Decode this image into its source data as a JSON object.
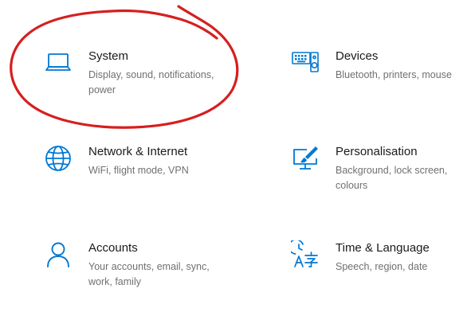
{
  "colors": {
    "accent": "#0078d4",
    "title": "#1a1a1a",
    "description": "#707070",
    "annotation": "#d61f1f"
  },
  "tiles": [
    {
      "icon": "laptop-icon",
      "title": "System",
      "description": "Display, sound, notifications, power"
    },
    {
      "icon": "keyboard-speaker-icon",
      "title": "Devices",
      "description": "Bluetooth, printers, mouse"
    },
    {
      "icon": "globe-icon",
      "title": "Network & Internet",
      "description": "WiFi, flight mode, VPN"
    },
    {
      "icon": "paint-monitor-icon",
      "title": "Personalisation",
      "description": "Background, lock screen, colours"
    },
    {
      "icon": "person-icon",
      "title": "Accounts",
      "description": "Your accounts, email, sync, work, family"
    },
    {
      "icon": "time-language-icon",
      "title": "Time & Language",
      "description": "Speech, region, date"
    }
  ]
}
